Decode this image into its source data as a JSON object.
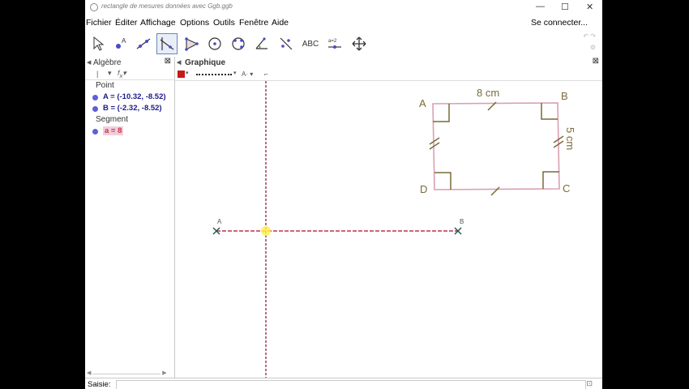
{
  "window": {
    "title": "rectangle de mesures données avec Ggb.ggb",
    "minimize": "—",
    "maximize": "☐",
    "close": "✕"
  },
  "menu": {
    "items": [
      "Fichier",
      "Éditer",
      "Affichage",
      "Options",
      "Outils",
      "Fenêtre",
      "Aide"
    ],
    "connect": "Se connecter..."
  },
  "toolbar": {
    "tools": [
      {
        "name": "move",
        "icon": "arrow-icon"
      },
      {
        "name": "point",
        "icon": "point-icon"
      },
      {
        "name": "line",
        "icon": "line-icon"
      },
      {
        "name": "perpendicular",
        "icon": "perpendicular-icon",
        "active": true
      },
      {
        "name": "polygon",
        "icon": "polygon-icon"
      },
      {
        "name": "circle",
        "icon": "circle-icon"
      },
      {
        "name": "conic",
        "icon": "conic-icon"
      },
      {
        "name": "angle",
        "icon": "angle-icon"
      },
      {
        "name": "reflect",
        "icon": "reflect-icon"
      },
      {
        "name": "text",
        "icon": "text-icon",
        "label": "ABC"
      },
      {
        "name": "slider",
        "icon": "slider-icon",
        "label": "a=2"
      },
      {
        "name": "move-view",
        "icon": "move-view-icon"
      }
    ]
  },
  "algebra": {
    "title": "Algèbre",
    "categories": [
      {
        "label": "Point",
        "items": [
          "A = (-10.32, -8.52)",
          "B = (-2.32, -8.52)"
        ]
      },
      {
        "label": "Segment",
        "items": [
          "a = 8"
        ]
      }
    ]
  },
  "graphics": {
    "title": "Graphique",
    "point_a_label": "A",
    "point_b_label": "B",
    "figure": {
      "corners": [
        "A",
        "B",
        "C",
        "D"
      ],
      "width_label": "8 cm",
      "height_label": "5 cm"
    }
  },
  "input": {
    "label": "Saisie:"
  },
  "colors": {
    "segment": "#c03050",
    "axis_dashed": "#8a2040",
    "rectangle": "#d8a0b0",
    "figure_text": "#7a6a3a",
    "cursor": "#ffee55"
  }
}
